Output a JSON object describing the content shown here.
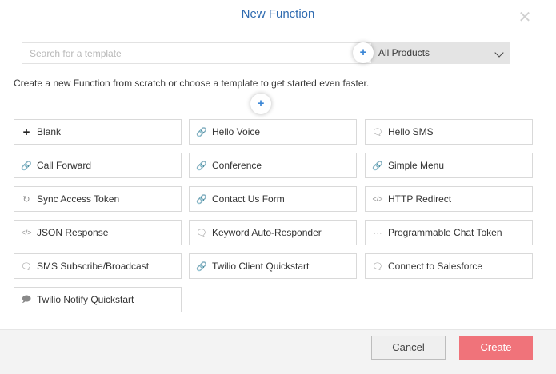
{
  "dialog": {
    "title": "New Function",
    "close_icon": "close-icon"
  },
  "search": {
    "placeholder": "Search for a template"
  },
  "filter": {
    "selected": "All Products"
  },
  "description": "Create a new Function from scratch or choose a template to get started even faster.",
  "templates": [
    {
      "label": "Blank",
      "icon": "plus-icon"
    },
    {
      "label": "Hello Voice",
      "icon": "link-icon"
    },
    {
      "label": "Hello SMS",
      "icon": "chat-icon"
    },
    {
      "label": "Call Forward",
      "icon": "link-icon"
    },
    {
      "label": "Conference",
      "icon": "link-icon"
    },
    {
      "label": "Simple Menu",
      "icon": "link-icon"
    },
    {
      "label": "Sync Access Token",
      "icon": "sync-icon"
    },
    {
      "label": "Contact Us Form",
      "icon": "link-icon"
    },
    {
      "label": "HTTP Redirect",
      "icon": "code-icon"
    },
    {
      "label": "JSON Response",
      "icon": "code-icon"
    },
    {
      "label": "Keyword Auto-Responder",
      "icon": "chat-icon"
    },
    {
      "label": "Programmable Chat Token",
      "icon": "chat-dots-icon"
    },
    {
      "label": "SMS Subscribe/Broadcast",
      "icon": "chat-icon"
    },
    {
      "label": "Twilio Client Quickstart",
      "icon": "link-icon"
    },
    {
      "label": "Connect to Salesforce",
      "icon": "chat-icon"
    },
    {
      "label": "Twilio Notify Quickstart",
      "icon": "notify-icon"
    }
  ],
  "footer": {
    "cancel_label": "Cancel",
    "create_label": "Create"
  },
  "colors": {
    "title": "#2f6bb0",
    "create_button": "#f0737a",
    "plus_button": "#3a86d6"
  }
}
